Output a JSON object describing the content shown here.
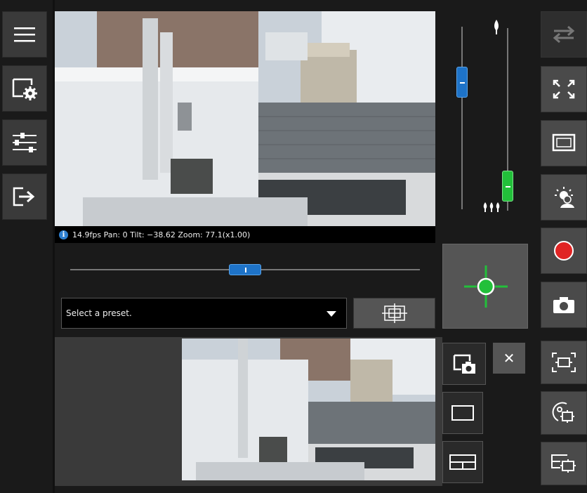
{
  "status": {
    "info_glyph": "i",
    "text": "14.9fps Pan: 0 Tilt: −38.62 Zoom: 77.1(x1.00)"
  },
  "preset": {
    "placeholder": "Select a preset."
  },
  "close_glyph": "✕",
  "sliders": {
    "pan_position": 0.5,
    "tilt_position": 0.22,
    "focus_position": 0.95
  },
  "icons": {
    "menu": "hamburger-icon",
    "settings": "screen-settings-icon",
    "image_adjust": "sliders-icon",
    "logout": "exit-icon",
    "swap": "swap-arrows-icon",
    "fullscreen": "expand-icon",
    "display": "monitor-icon",
    "light": "backlight-icon",
    "record": "record-icon",
    "snapshot": "camera-icon",
    "area_select": "area-select-icon",
    "auto_tracking": "tracking-icon",
    "multi_view": "multi-view-icon"
  },
  "colors": {
    "record": "#e02424",
    "ptz_accent": "#22c03a",
    "slider_blue": "#1e73c8"
  }
}
